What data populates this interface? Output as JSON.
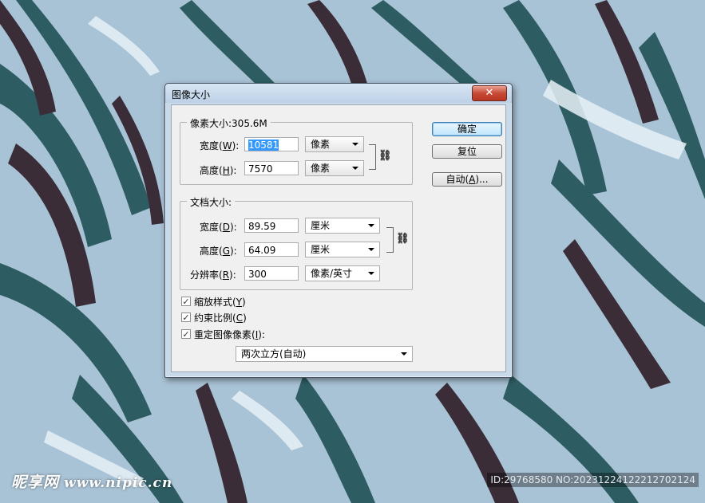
{
  "dialog": {
    "title": "图像大小",
    "close_glyph": "✕",
    "pixel_section": {
      "title": "像素大小:305.6M",
      "width_label": "宽度(",
      "width_key": "W",
      "width_suffix": "):",
      "width_value": "10581",
      "width_unit": "像素",
      "height_label": "高度(",
      "height_key": "H",
      "height_suffix": "):",
      "height_value": "7570",
      "height_unit": "像素"
    },
    "doc_section": {
      "title": "文档大小:",
      "width_label": "宽度(",
      "width_key": "D",
      "width_suffix": "):",
      "width_value": "89.59",
      "width_unit": "厘米",
      "height_label": "高度(",
      "height_key": "G",
      "height_suffix": "):",
      "height_value": "64.09",
      "height_unit": "厘米",
      "res_label": "分辨率(",
      "res_key": "R",
      "res_suffix": "):",
      "res_value": "300",
      "res_unit": "像素/英寸"
    },
    "checkboxes": {
      "scale_styles": "缩放样式(",
      "scale_styles_key": "Y",
      "scale_styles_suffix": ")",
      "constrain": "约束比例(",
      "constrain_key": "C",
      "constrain_suffix": ")",
      "resample": "重定图像像素(",
      "resample_key": "I",
      "resample_suffix": "):"
    },
    "resample_method": "两次立方(自动)",
    "buttons": {
      "ok": "确定",
      "reset": "复位",
      "auto_prefix": "自动(",
      "auto_key": "A",
      "auto_suffix": ")..."
    }
  },
  "watermark": {
    "brand": "昵享网",
    "url": "www.nipic.cn",
    "id_text": "ID:29768580 NO:20231224122212702124"
  }
}
